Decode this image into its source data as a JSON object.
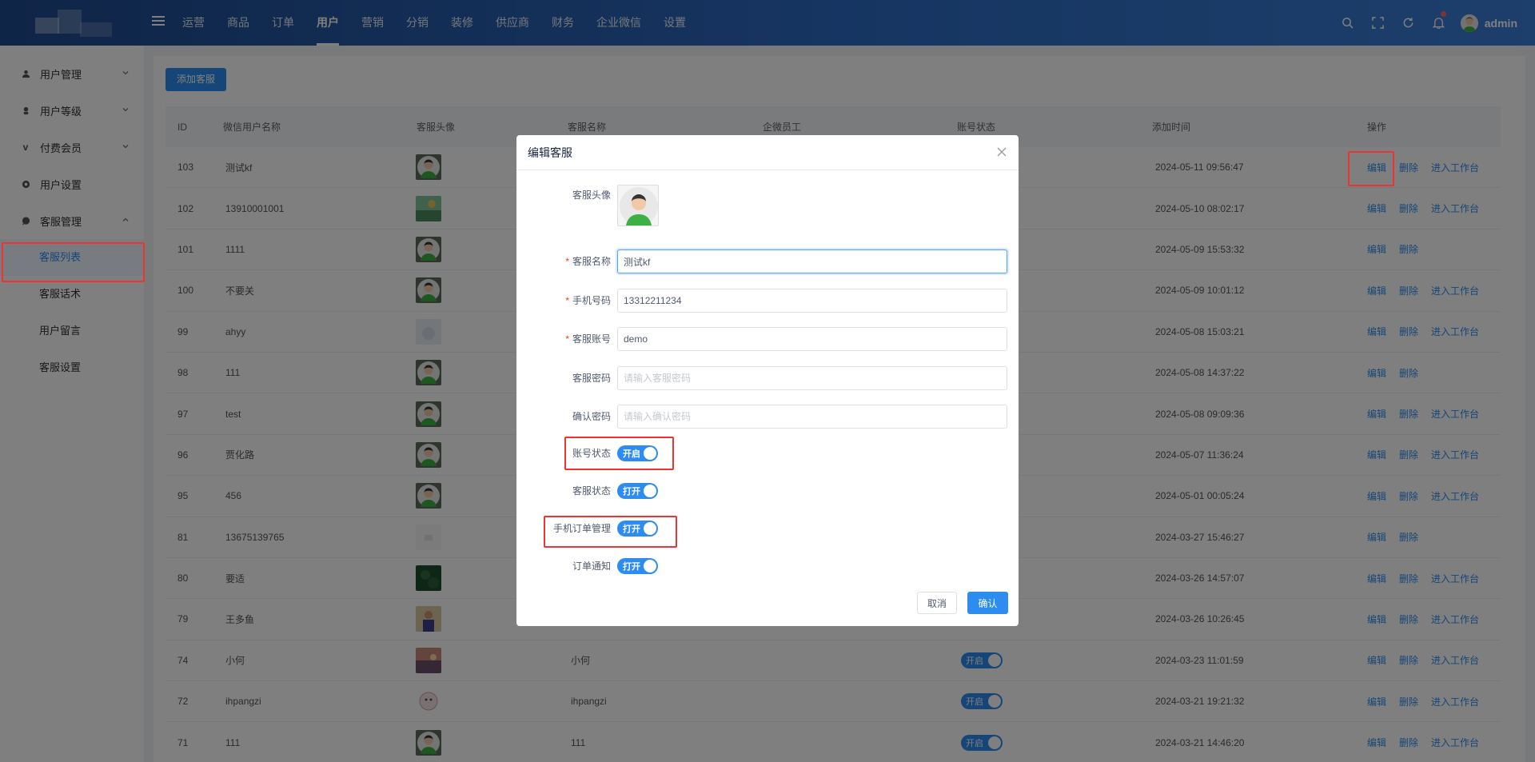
{
  "header": {
    "nav": [
      "运营",
      "商品",
      "订单",
      "用户",
      "营销",
      "分销",
      "装修",
      "供应商",
      "财务",
      "企业微信",
      "设置"
    ],
    "active_nav": "用户",
    "user_name": "admin"
  },
  "sidebar": {
    "groups": [
      {
        "label": "用户管理",
        "icon": "user-icon"
      },
      {
        "label": "用户等级",
        "icon": "level-icon"
      },
      {
        "label": "付费会员",
        "icon": "vip-icon"
      },
      {
        "label": "用户设置",
        "icon": "settings-icon"
      },
      {
        "label": "客服管理",
        "icon": "chat-icon"
      }
    ],
    "subitems": [
      "客服列表",
      "客服话术",
      "用户留言",
      "客服设置"
    ],
    "active_subitem": "客服列表"
  },
  "main": {
    "add_button": "添加客服",
    "columns": [
      "ID",
      "微信用户名称",
      "客服头像",
      "客服名称",
      "企微员工",
      "账号状态",
      "添加时间",
      "操作"
    ],
    "ops": {
      "edit": "编辑",
      "delete": "删除",
      "enter": "进入工作台"
    },
    "switch_on": "开启",
    "rows": [
      {
        "id": "103",
        "wx_name": "测试kf",
        "name": "",
        "time": "2024-05-11 09:56:47",
        "enter": true,
        "status": false,
        "avatar": "male"
      },
      {
        "id": "102",
        "wx_name": "13910001001",
        "name": "",
        "time": "2024-05-10 08:02:17",
        "enter": true,
        "status": false,
        "avatar": "green"
      },
      {
        "id": "101",
        "wx_name": "1111",
        "name": "",
        "time": "2024-05-09 15:53:32",
        "enter": false,
        "status": false,
        "avatar": "male"
      },
      {
        "id": "100",
        "wx_name": "不要关",
        "name": "",
        "time": "2024-05-09 10:01:12",
        "enter": true,
        "status": false,
        "avatar": "male"
      },
      {
        "id": "99",
        "wx_name": "ahyy",
        "name": "",
        "time": "2024-05-08 15:03:21",
        "enter": true,
        "status": false,
        "avatar": "light"
      },
      {
        "id": "98",
        "wx_name": "111",
        "name": "",
        "time": "2024-05-08 14:37:22",
        "enter": false,
        "status": false,
        "avatar": "male"
      },
      {
        "id": "97",
        "wx_name": "test",
        "name": "",
        "time": "2024-05-08 09:09:36",
        "enter": true,
        "status": false,
        "avatar": "male"
      },
      {
        "id": "96",
        "wx_name": "贾化路",
        "name": "",
        "time": "2024-05-07 11:36:24",
        "enter": true,
        "status": false,
        "avatar": "male"
      },
      {
        "id": "95",
        "wx_name": "456",
        "name": "",
        "time": "2024-05-01 00:05:24",
        "enter": true,
        "status": false,
        "avatar": "male"
      },
      {
        "id": "81",
        "wx_name": "13675139765",
        "name": "",
        "time": "2024-03-27 15:46:27",
        "enter": false,
        "status": false,
        "avatar": "blank"
      },
      {
        "id": "80",
        "wx_name": "要适",
        "name": "",
        "time": "2024-03-26 14:57:07",
        "enter": true,
        "status": false,
        "avatar": "dark"
      },
      {
        "id": "79",
        "wx_name": "王多鱼",
        "name": "",
        "time": "2024-03-26 10:26:45",
        "enter": true,
        "status": false,
        "avatar": "person"
      },
      {
        "id": "74",
        "wx_name": "小何",
        "name": "小何",
        "time": "2024-03-23 11:01:59",
        "enter": true,
        "status": true,
        "avatar": "sunset"
      },
      {
        "id": "72",
        "wx_name": "ihpangzi",
        "name": "ihpangzi",
        "time": "2024-03-21 19:21:32",
        "enter": true,
        "status": true,
        "avatar": "sketch"
      },
      {
        "id": "71",
        "wx_name": "111",
        "name": "111",
        "time": "2024-03-21 14:46:20",
        "enter": true,
        "status": true,
        "avatar": "male"
      }
    ]
  },
  "dialog": {
    "title": "编辑客服",
    "avatar_label": "客服头像",
    "name_label": "客服名称",
    "name_value": "测试kf",
    "phone_label": "手机号码",
    "phone_value": "13312211234",
    "account_label": "客服账号",
    "account_value": "demo",
    "password_label": "客服密码",
    "password_placeholder": "请输入客服密码",
    "confirm_label": "确认密码",
    "confirm_placeholder": "请输入确认密码",
    "account_status_label": "账号状态",
    "account_status_text": "开启",
    "service_status_label": "客服状态",
    "service_status_text": "打开",
    "mobile_order_label": "手机订单管理",
    "mobile_order_text": "打开",
    "order_notify_label": "订单通知",
    "order_notify_text": "打开",
    "cancel": "取消",
    "ok": "确认"
  },
  "colors": {
    "primary": "#2d8cf0",
    "header": "#2d6bc4",
    "highlight": "#e33333"
  }
}
